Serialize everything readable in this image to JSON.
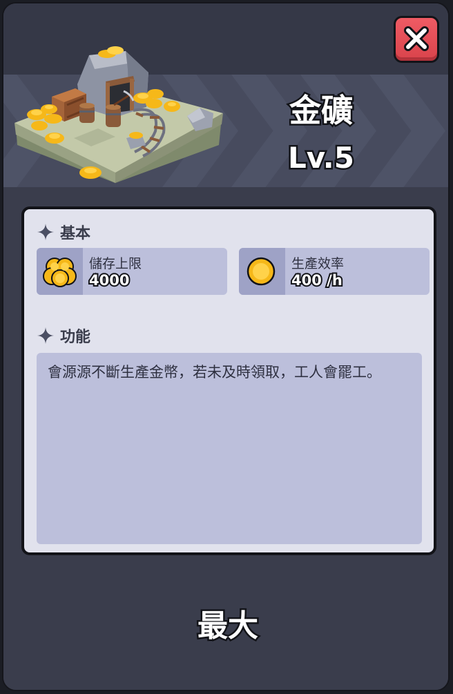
{
  "building": {
    "name": "金礦",
    "level": "Lv.5"
  },
  "sections": {
    "basic": {
      "title": "基本",
      "stats": [
        {
          "label": "儲存上限",
          "value": "4000",
          "icon": "gold-coins-stack-icon"
        },
        {
          "label": "生產效率",
          "value": "400 /h",
          "icon": "gold-coin-icon"
        }
      ]
    },
    "function": {
      "title": "功能",
      "description": "會源源不斷生產金幣，若未及時領取，工人會罷工。"
    }
  },
  "footer": {
    "max_label": "最大"
  },
  "colors": {
    "panel": "#3a3d4c",
    "banner": "#474b5e",
    "card": "#e1e2ed",
    "stat_bg": "#bcbfdb",
    "close_red": "#e44c55",
    "gold": "#f6b819"
  }
}
